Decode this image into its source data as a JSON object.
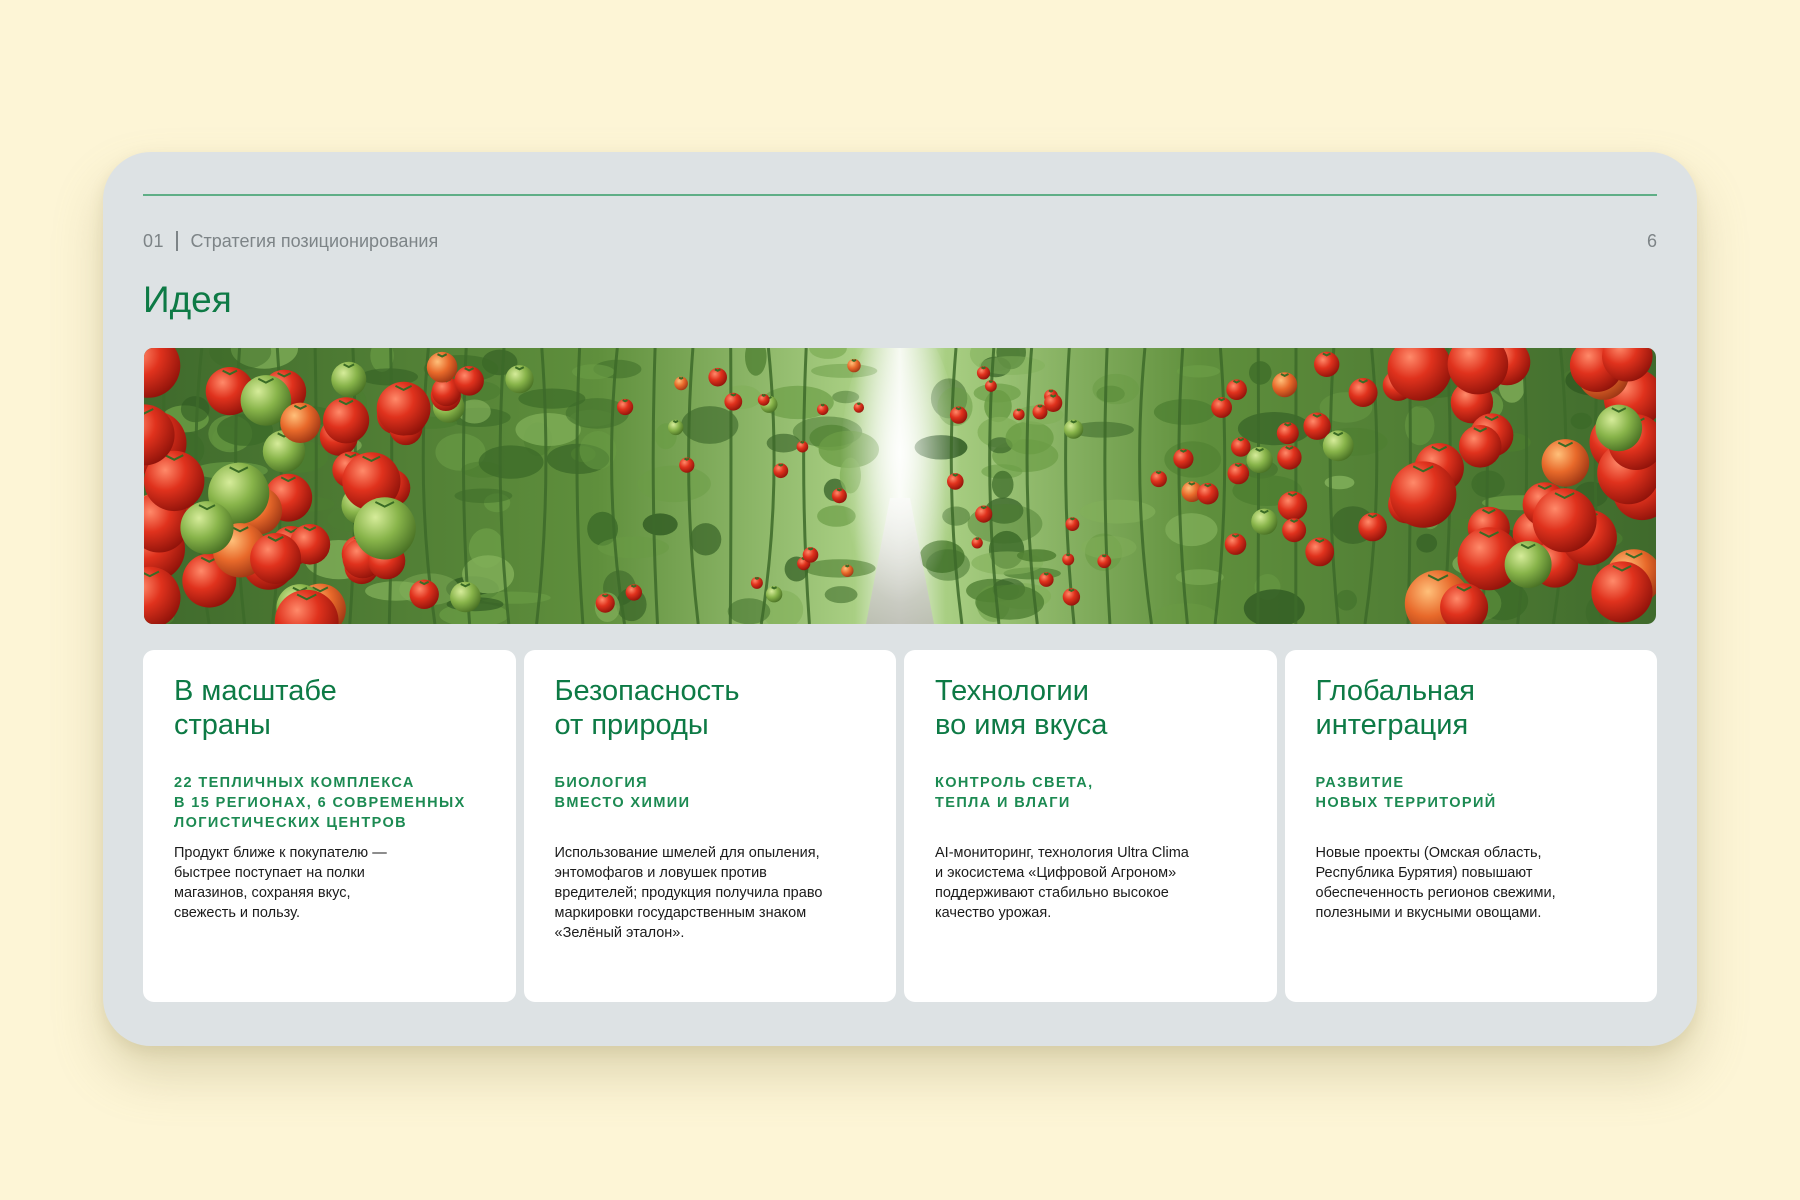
{
  "header": {
    "section_number": "01",
    "section_title": "Стратегия позиционирования",
    "page_number": "6"
  },
  "title": "Идея",
  "image": {
    "subject": "tomato-greenhouse-photo"
  },
  "colors": {
    "background": "#fdf5d6",
    "slide": "#dde2e4",
    "accent_green": "#0d7a45",
    "rule_green": "#5fae86",
    "card": "#ffffff"
  },
  "cards": [
    {
      "title": "В масштабе\nстраны",
      "subtitle": "22 ТЕПЛИЧНЫХ КОМПЛЕКСА\nВ 15 РЕГИОНАХ, 6 СОВРЕМЕННЫХ\nЛОГИСТИЧЕСКИХ ЦЕНТРОВ",
      "text": "Продукт ближе к покупателю —\nбыстрее поступает на полки\nмагазинов, сохраняя вкус,\nсвежесть и пользу."
    },
    {
      "title": "Безопасность\nот природы",
      "subtitle": "БИОЛОГИЯ\nВМЕСТО ХИМИИ",
      "text": "Использование шмелей для опыления,\nэнтомофагов и ловушек против\nвредителей; продукция получила право\nмаркировки государственным знаком\n«Зелёный эталон»."
    },
    {
      "title": "Технологии\nво имя вкуса",
      "subtitle": "КОНТРОЛЬ СВЕТА,\nТЕПЛА И ВЛАГИ",
      "text": "AI-мониторинг, технология Ultra Clima\nи экосистема «Цифровой Агроном»\nподдерживают стабильно высокое\nкачество урожая."
    },
    {
      "title": "Глобальная\nинтеграция",
      "subtitle": "РАЗВИТИЕ\nНОВЫХ ТЕРРИТОРИЙ",
      "text": "Новые проекты (Омская область,\nРеспублика Бурятия) повышают\nобеспеченность регионов свежими,\nполезными и вкусными овощами."
    }
  ]
}
